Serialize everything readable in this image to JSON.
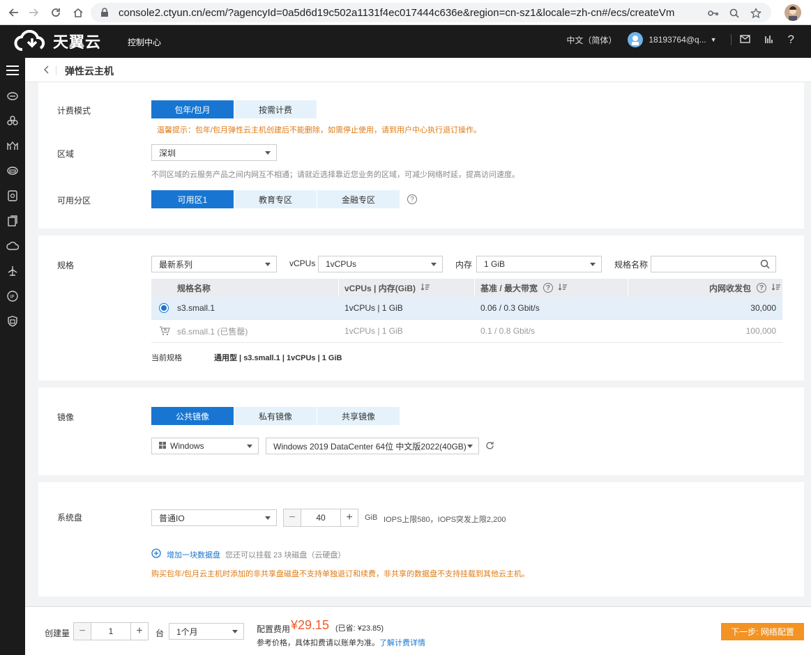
{
  "browser": {
    "url": "console2.ctyun.cn/ecm/?agencyId=0a5d6d19c502a1131f4ec017444c636e&region=cn-sz1&locale=zh-cn#/ecs/createVm"
  },
  "header": {
    "logo_text": "天翼云",
    "console_link": "控制中心",
    "language": "中文（简体）",
    "username": "18193764@q..."
  },
  "sidebar": {
    "icons": [
      "menu-icon",
      "cloud-host-icon",
      "cluster-icon",
      "bridge-icon",
      "disk-icon",
      "storage-icon",
      "backup-icon",
      "cloud-icon",
      "network-icon",
      "ip-icon",
      "security-icon"
    ]
  },
  "page": {
    "title": "弹性云主机"
  },
  "billing": {
    "label": "计费模式",
    "options": [
      "包年/包月",
      "按需计费"
    ],
    "warning": "温馨提示：包年/包月弹性云主机创建后不能删除，如需停止使用，请到用户中心执行退订操作。"
  },
  "region": {
    "label": "区域",
    "value": "深圳",
    "hint": "不同区域的云服务产品之间内网互不相通；请就近选择靠近您业务的区域，可减少网络时延，提高访问速度。"
  },
  "zone": {
    "label": "可用分区",
    "options": [
      "可用区1",
      "教育专区",
      "金融专区"
    ]
  },
  "spec": {
    "label": "规格",
    "series_value": "最新系列",
    "vcpu_label": "vCPUs",
    "vcpu_value": "1vCPUs",
    "mem_label": "内存",
    "mem_value": "1 GiB",
    "name_label": "规格名称",
    "columns": [
      "规格名称",
      "vCPUs | 内存(GiB)",
      "基准 / 最大带宽",
      "内网收发包"
    ],
    "rows": [
      {
        "name": "s3.small.1",
        "cpu_mem": "1vCPUs | 1 GiB",
        "bandwidth": "0.06 / 0.3 Gbit/s",
        "pps": "30,000"
      },
      {
        "name": "s6.small.1 (已售罄)",
        "cpu_mem": "1vCPUs | 1 GiB",
        "bandwidth": "0.1 / 0.8 Gbit/s",
        "pps": "100,000"
      }
    ],
    "current_label": "当前规格",
    "current_value": "通用型 | s3.small.1 | 1vCPUs | 1 GiB"
  },
  "image": {
    "label": "镜像",
    "options": [
      "公共镜像",
      "私有镜像",
      "共享镜像"
    ],
    "os_value": "Windows",
    "version_value": "Windows 2019 DataCenter 64位 中文版2022(40GB)"
  },
  "disk": {
    "label": "系统盘",
    "type_value": "普通IO",
    "size": "40",
    "unit": "GiB",
    "iops": "IOPS上限580，IOPS突发上限2,200",
    "add_link": "增加一块数据盘",
    "add_hint": "您还可以挂载 23 块磁盘（云硬盘）",
    "warning": "购买包年/包月云主机时添加的非共享盘磁盘不支持单独退订和续费，非共享的数据盘不支持挂载到其他云主机。"
  },
  "footer": {
    "qty_label": "创建量",
    "qty_value": "1",
    "qty_unit": "台",
    "duration_value": "1个月",
    "price_label": "配置费用",
    "price": "¥29.15",
    "saved": "(已省: ¥23.85)",
    "note": "参考价格，具体扣费请以账单为准。",
    "detail_link": "了解计费详情",
    "next_button": "下一步: 网络配置"
  }
}
